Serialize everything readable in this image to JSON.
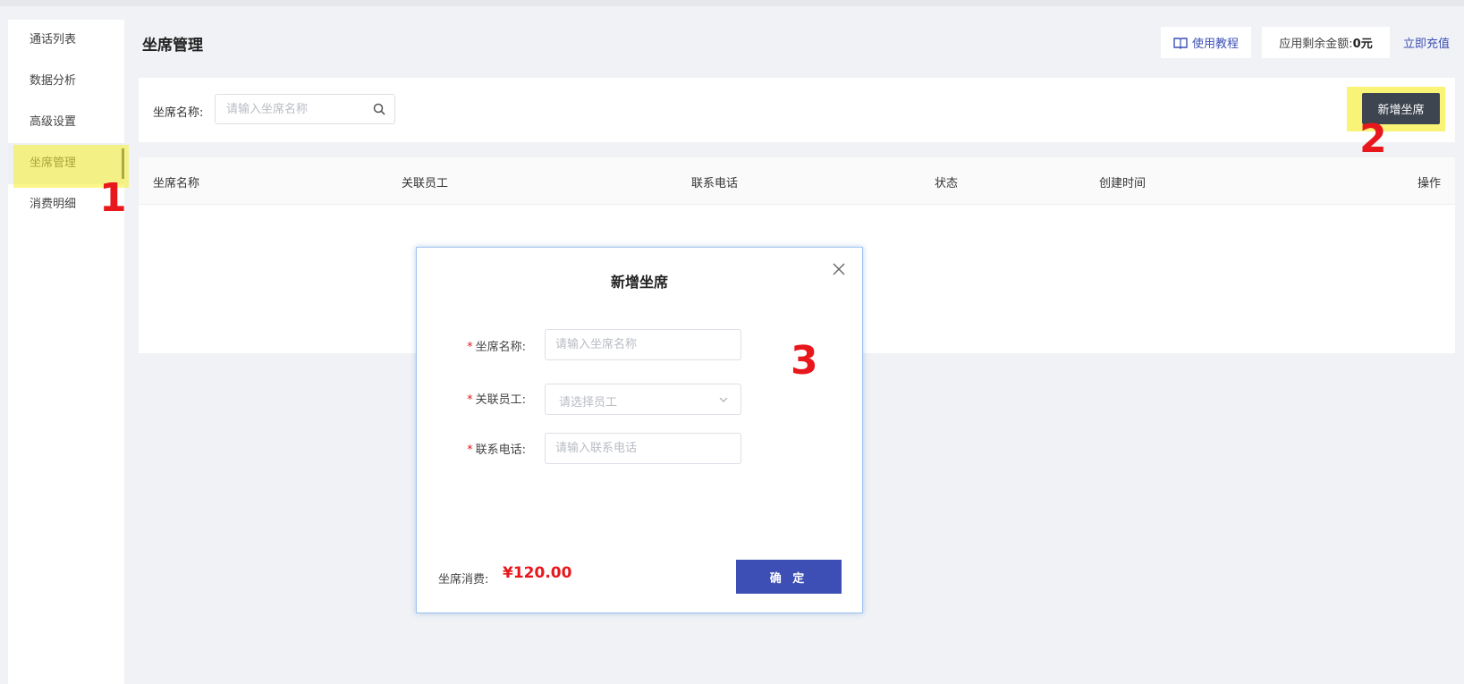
{
  "sidebar": {
    "items": [
      {
        "label": "通话列表"
      },
      {
        "label": "数据分析"
      },
      {
        "label": "高级设置"
      },
      {
        "label": "坐席管理"
      },
      {
        "label": "消费明细"
      }
    ],
    "active_index": 3
  },
  "header": {
    "title": "坐席管理",
    "tutorial_label": "使用教程",
    "balance_label": "应用剩余金额:",
    "balance_value": "0元",
    "recharge_label": "立即充值"
  },
  "filter": {
    "name_label": "坐席名称:",
    "name_placeholder": "请输入坐席名称",
    "add_button": "新增坐席"
  },
  "table": {
    "columns": [
      "坐席名称",
      "关联员工",
      "联系电话",
      "状态",
      "创建时间",
      "操作"
    ],
    "rows": []
  },
  "modal": {
    "title": "新增坐席",
    "fields": [
      {
        "required": "*",
        "label": "坐席名称:",
        "placeholder": "请输入坐席名称"
      },
      {
        "required": "*",
        "label": "关联员工:",
        "placeholder": "请选择员工"
      },
      {
        "required": "*",
        "label": "联系电话:",
        "placeholder": "请输入联系电话"
      }
    ],
    "fee_label": "坐席消费:",
    "fee_value": "¥120.00",
    "confirm_button": "确 定"
  },
  "annotations": {
    "step1": "1",
    "step2": "2",
    "step3": "3"
  },
  "colors": {
    "highlight": "#f6f03c",
    "annotation": "#e8171c",
    "primary": "#3d4fb5",
    "dark_button": "#3d4550"
  }
}
